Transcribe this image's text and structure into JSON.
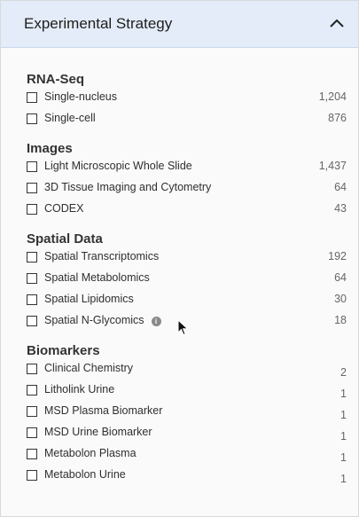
{
  "header": {
    "title": "Experimental Strategy"
  },
  "sections": [
    {
      "title": "RNA-Seq",
      "items": [
        {
          "label": "Single-nucleus",
          "count": "1,204"
        },
        {
          "label": "Single-cell",
          "count": "876"
        }
      ]
    },
    {
      "title": "Images",
      "items": [
        {
          "label": "Light Microscopic Whole Slide",
          "count": "1,437"
        },
        {
          "label": "3D Tissue Imaging and Cytometry",
          "count": "64"
        },
        {
          "label": "CODEX",
          "count": "43"
        }
      ]
    },
    {
      "title": "Spatial Data",
      "items": [
        {
          "label": "Spatial Transcriptomics",
          "count": "192"
        },
        {
          "label": "Spatial Metabolomics",
          "count": "64"
        },
        {
          "label": "Spatial Lipidomics",
          "count": "30"
        },
        {
          "label": "Spatial N-Glycomics",
          "count": "18",
          "info_icon": "info-icon"
        }
      ]
    },
    {
      "title": "Biomarkers",
      "items": [
        {
          "label": "Clinical Chemistry",
          "count": "2"
        },
        {
          "label": "Litholink Urine",
          "count": "1"
        },
        {
          "label": "MSD Plasma Biomarker",
          "count": "1"
        },
        {
          "label": "MSD Urine Biomarker",
          "count": "1"
        },
        {
          "label": "Metabolon Plasma",
          "count": "1"
        },
        {
          "label": "Metabolon Urine",
          "count": "1"
        }
      ]
    }
  ],
  "icons": {
    "collapse": "chevron-up-icon",
    "cursor": "mouse-pointer-icon",
    "info": "info-icon"
  }
}
